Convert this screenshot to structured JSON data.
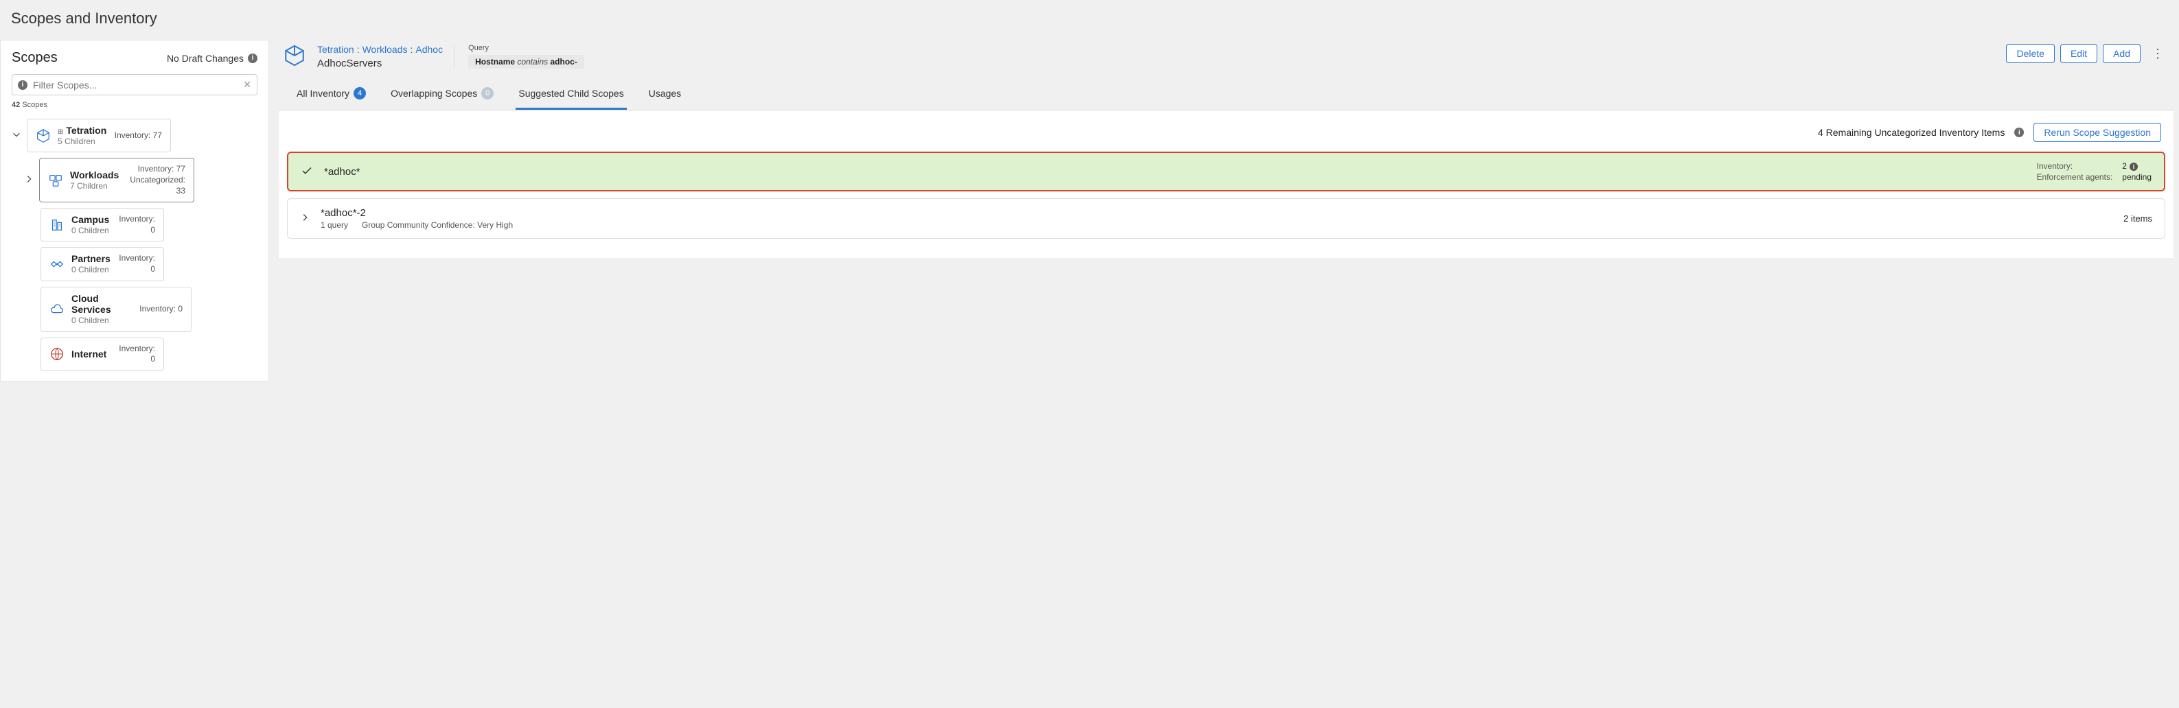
{
  "page_title": "Scopes and Inventory",
  "sidebar": {
    "title": "Scopes",
    "draft_status": "No Draft Changes",
    "filter_placeholder": "Filter Scopes...",
    "scope_count_num": "42",
    "scope_count_label": "Scopes",
    "tree": {
      "root": {
        "name": "Tetration",
        "children_label": "5 Children",
        "inventory_label": "Inventory: 77"
      },
      "workloads": {
        "name": "Workloads",
        "children_label": "7 Children",
        "inventory_label": "Inventory: 77",
        "uncat_label": "Uncategorized: 33"
      },
      "campus": {
        "name": "Campus",
        "children_label": "0 Children",
        "inventory_label": "Inventory: 0"
      },
      "partners": {
        "name": "Partners",
        "children_label": "0 Children",
        "inventory_label": "Inventory: 0"
      },
      "cloud": {
        "name": "Cloud Services",
        "children_label": "0 Children",
        "inventory_label": "Inventory: 0"
      },
      "internet": {
        "name": "Internet",
        "inventory_label": "Inventory: 0"
      }
    }
  },
  "header": {
    "breadcrumb": {
      "a": "Tetration",
      "b": "Workloads",
      "c": "Adhoc"
    },
    "scope_name": "AdhocServers",
    "query": {
      "label": "Query",
      "field": "Hostname",
      "operator": "contains",
      "value": "adhoc-"
    },
    "actions": {
      "delete": "Delete",
      "edit": "Edit",
      "add": "Add"
    }
  },
  "tabs": {
    "all_inv": "All Inventory",
    "all_inv_count": "4",
    "overlap": "Overlapping Scopes",
    "overlap_count": "0",
    "suggested": "Suggested Child Scopes",
    "usages": "Usages"
  },
  "content": {
    "remaining_text": "4 Remaining Uncategorized Inventory Items",
    "rerun_btn": "Rerun Scope Suggestion",
    "row1": {
      "name": "*adhoc*",
      "inv_k": "Inventory:",
      "inv_v": "2",
      "enf_k": "Enforcement agents:",
      "enf_v": "pending"
    },
    "row2": {
      "name": "*adhoc*-2",
      "queries": "1 query",
      "confidence": "Group Community Confidence: Very High",
      "items": "2 items"
    }
  }
}
